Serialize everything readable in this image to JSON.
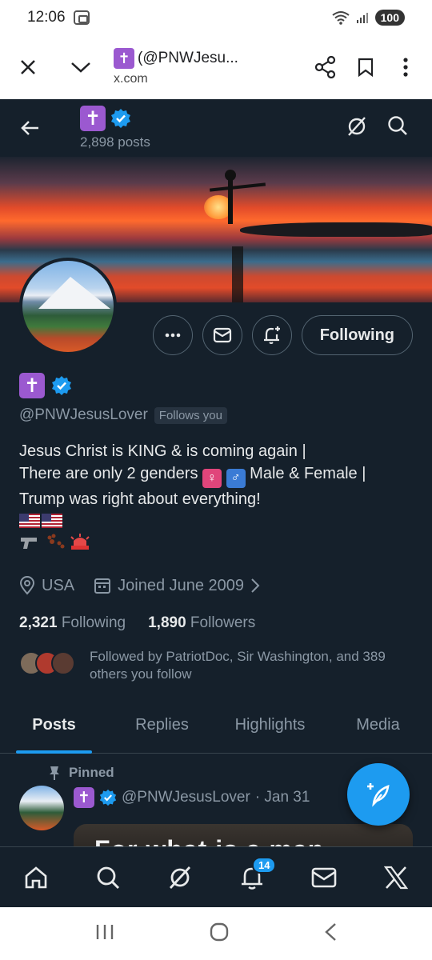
{
  "status_bar": {
    "time": "12:06",
    "battery": "100"
  },
  "browser": {
    "title": "(@PNWJesu...",
    "host": "x.com"
  },
  "header": {
    "posts": "2,898 posts"
  },
  "profile": {
    "handle": "@PNWJesusLover",
    "follows_you": "Follows you",
    "bio_line1": "Jesus Christ is KING & is coming again |",
    "bio_line2a": "There are only 2 genders",
    "bio_line2b": "Male & Female |",
    "bio_line3": "Trump was right about everything!",
    "location": "USA",
    "joined": "Joined June 2009",
    "following_count": "2,321",
    "following_label": "Following",
    "followers_count": "1,890",
    "followers_label": "Followers",
    "followed_by": "Followed by PatriotDoc, Sir Washington, and 389 others you follow"
  },
  "actions": {
    "following_label": "Following"
  },
  "tabs": [
    {
      "label": "Posts"
    },
    {
      "label": "Replies"
    },
    {
      "label": "Highlights"
    },
    {
      "label": "Media"
    }
  ],
  "pinned": {
    "label": "Pinned",
    "handle": "@PNWJesusLover",
    "date": "· Jan 31",
    "media_text": "For what is a man"
  },
  "bottom_nav": {
    "notif_count": "14"
  },
  "colors": {
    "bg": "#15202b",
    "accent": "#1d9bf0",
    "muted": "#8b98a5",
    "cross": "#9b59d0"
  },
  "icons": [
    "close-icon",
    "chevron-down-icon",
    "share-icon",
    "bookmark-icon",
    "more-vert-icon",
    "back-arrow-icon",
    "grok-icon",
    "search-icon",
    "more-icon",
    "mail-icon",
    "notification-add-icon",
    "location-icon",
    "calendar-icon",
    "pin-icon",
    "compose-icon",
    "home-icon",
    "bell-icon",
    "x-logo-icon"
  ]
}
